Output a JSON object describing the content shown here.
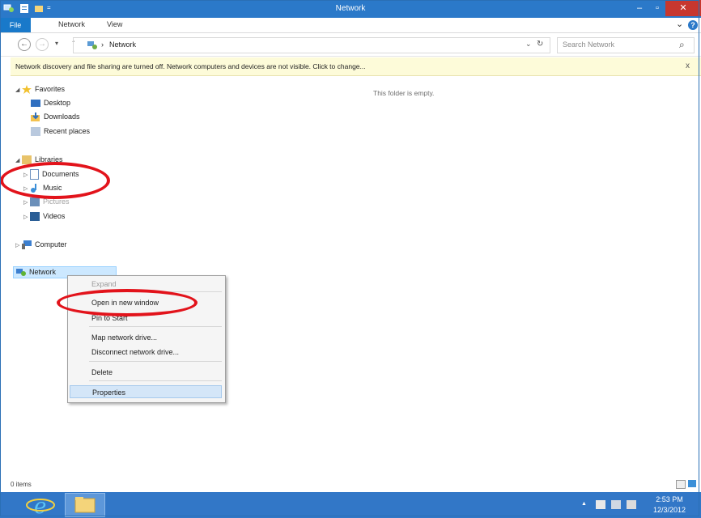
{
  "window": {
    "title": "Network",
    "minimize": "–",
    "maximize": "▫",
    "close": "✕"
  },
  "ribbon": {
    "tabs": [
      "File",
      "Network",
      "View"
    ],
    "expand": "⌄",
    "help": "?"
  },
  "address": {
    "back": "←",
    "forward": "→",
    "recent": "▾",
    "up": "↑",
    "path_sep": "›",
    "path": "Network",
    "dropdown": "⌄",
    "refresh": "↻",
    "search_placeholder": "Search Network",
    "search_icon": "⌕"
  },
  "infobar": {
    "message": "Network discovery and file sharing are turned off. Network computers and devices are not visible. Click to change...",
    "close": "x"
  },
  "nav": {
    "favorites": {
      "label": "Favorites",
      "items": [
        "Desktop",
        "Downloads",
        "Recent places"
      ]
    },
    "libraries": {
      "label": "Libraries",
      "items": [
        "Documents",
        "Music",
        "Pictures",
        "Videos"
      ]
    },
    "computer": "Computer",
    "network": "Network"
  },
  "content": {
    "empty_message": "This folder is empty."
  },
  "context_menu": {
    "items": [
      "Expand",
      "Open in new window",
      "Pin to Start",
      "Map network drive...",
      "Disconnect network drive...",
      "Delete",
      "Properties"
    ]
  },
  "status": {
    "items_count": "0 items"
  },
  "taskbar": {
    "time": "2:53 PM",
    "date": "12/3/2012",
    "tray_chevron": "▲"
  },
  "colors": {
    "title_bar": "#2b79c9",
    "file_tab": "#1979ca",
    "infobar": "#fdfbd9",
    "taskbar": "#3277c7",
    "annotation": "#e2131b",
    "selection": "#cce8ff"
  }
}
